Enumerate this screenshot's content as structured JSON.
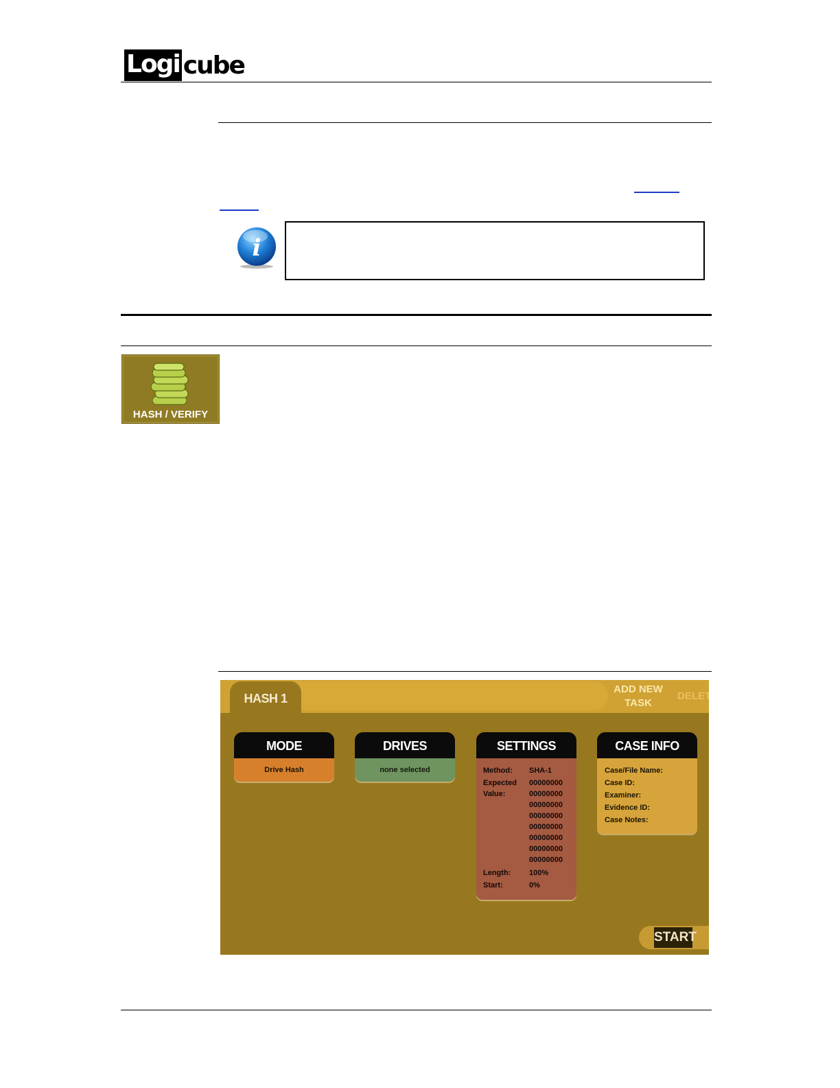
{
  "header": {
    "logo_text": "Logicube",
    "logo_boxed": "Logi",
    "logo_tail": "cube"
  },
  "hash_verify_icon": {
    "label": "HASH / VERIFY"
  },
  "ui": {
    "tab_label": "HASH 1",
    "add_task_line1": "ADD NEW",
    "add_task_line2": "TASK",
    "delete_label": "DELETE",
    "mode": {
      "title": "MODE",
      "value": "Drive Hash"
    },
    "drives": {
      "title": "DRIVES",
      "value": "none selected"
    },
    "settings": {
      "title": "SETTINGS",
      "method_label": "Method:",
      "method_value": "SHA-1",
      "expected_label_1": "Expected",
      "expected_label_2": "Value:",
      "expected_values": [
        "00000000",
        "00000000",
        "00000000",
        "00000000",
        "00000000",
        "00000000",
        "00000000",
        "00000000"
      ],
      "length_label": "Length:",
      "length_value": "100%",
      "start_label": "Start:",
      "start_value": "0%"
    },
    "case_info": {
      "title": "CASE INFO",
      "fields": [
        "Case/File Name:",
        "Case ID:",
        "Examiner:",
        "Evidence ID:",
        "Case Notes:"
      ]
    },
    "start_label": "START"
  },
  "colors": {
    "panel_bg": "#98781f",
    "topbar": "#cfa233",
    "mode": "#d7802c",
    "drives": "#6f9460",
    "settings": "#a55a42",
    "case_info": "#d6a43a",
    "link": "#1a3cc8"
  }
}
